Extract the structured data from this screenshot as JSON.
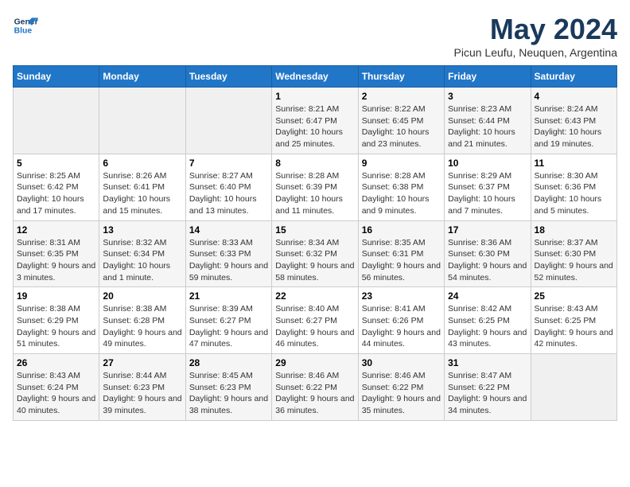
{
  "logo": {
    "line1": "General",
    "line2": "Blue"
  },
  "title": "May 2024",
  "subtitle": "Picun Leufu, Neuquen, Argentina",
  "headers": [
    "Sunday",
    "Monday",
    "Tuesday",
    "Wednesday",
    "Thursday",
    "Friday",
    "Saturday"
  ],
  "weeks": [
    [
      {
        "day": "",
        "empty": true
      },
      {
        "day": "",
        "empty": true
      },
      {
        "day": "",
        "empty": true
      },
      {
        "day": "1",
        "sunrise": "8:21 AM",
        "sunset": "6:47 PM",
        "daylight": "10 hours and 25 minutes."
      },
      {
        "day": "2",
        "sunrise": "8:22 AM",
        "sunset": "6:45 PM",
        "daylight": "10 hours and 23 minutes."
      },
      {
        "day": "3",
        "sunrise": "8:23 AM",
        "sunset": "6:44 PM",
        "daylight": "10 hours and 21 minutes."
      },
      {
        "day": "4",
        "sunrise": "8:24 AM",
        "sunset": "6:43 PM",
        "daylight": "10 hours and 19 minutes."
      }
    ],
    [
      {
        "day": "5",
        "sunrise": "8:25 AM",
        "sunset": "6:42 PM",
        "daylight": "10 hours and 17 minutes."
      },
      {
        "day": "6",
        "sunrise": "8:26 AM",
        "sunset": "6:41 PM",
        "daylight": "10 hours and 15 minutes."
      },
      {
        "day": "7",
        "sunrise": "8:27 AM",
        "sunset": "6:40 PM",
        "daylight": "10 hours and 13 minutes."
      },
      {
        "day": "8",
        "sunrise": "8:28 AM",
        "sunset": "6:39 PM",
        "daylight": "10 hours and 11 minutes."
      },
      {
        "day": "9",
        "sunrise": "8:28 AM",
        "sunset": "6:38 PM",
        "daylight": "10 hours and 9 minutes."
      },
      {
        "day": "10",
        "sunrise": "8:29 AM",
        "sunset": "6:37 PM",
        "daylight": "10 hours and 7 minutes."
      },
      {
        "day": "11",
        "sunrise": "8:30 AM",
        "sunset": "6:36 PM",
        "daylight": "10 hours and 5 minutes."
      }
    ],
    [
      {
        "day": "12",
        "sunrise": "8:31 AM",
        "sunset": "6:35 PM",
        "daylight": "9 hours and 3 minutes."
      },
      {
        "day": "13",
        "sunrise": "8:32 AM",
        "sunset": "6:34 PM",
        "daylight": "10 hours and 1 minute."
      },
      {
        "day": "14",
        "sunrise": "8:33 AM",
        "sunset": "6:33 PM",
        "daylight": "9 hours and 59 minutes."
      },
      {
        "day": "15",
        "sunrise": "8:34 AM",
        "sunset": "6:32 PM",
        "daylight": "9 hours and 58 minutes."
      },
      {
        "day": "16",
        "sunrise": "8:35 AM",
        "sunset": "6:31 PM",
        "daylight": "9 hours and 56 minutes."
      },
      {
        "day": "17",
        "sunrise": "8:36 AM",
        "sunset": "6:30 PM",
        "daylight": "9 hours and 54 minutes."
      },
      {
        "day": "18",
        "sunrise": "8:37 AM",
        "sunset": "6:30 PM",
        "daylight": "9 hours and 52 minutes."
      }
    ],
    [
      {
        "day": "19",
        "sunrise": "8:38 AM",
        "sunset": "6:29 PM",
        "daylight": "9 hours and 51 minutes."
      },
      {
        "day": "20",
        "sunrise": "8:38 AM",
        "sunset": "6:28 PM",
        "daylight": "9 hours and 49 minutes."
      },
      {
        "day": "21",
        "sunrise": "8:39 AM",
        "sunset": "6:27 PM",
        "daylight": "9 hours and 47 minutes."
      },
      {
        "day": "22",
        "sunrise": "8:40 AM",
        "sunset": "6:27 PM",
        "daylight": "9 hours and 46 minutes."
      },
      {
        "day": "23",
        "sunrise": "8:41 AM",
        "sunset": "6:26 PM",
        "daylight": "9 hours and 44 minutes."
      },
      {
        "day": "24",
        "sunrise": "8:42 AM",
        "sunset": "6:25 PM",
        "daylight": "9 hours and 43 minutes."
      },
      {
        "day": "25",
        "sunrise": "8:43 AM",
        "sunset": "6:25 PM",
        "daylight": "9 hours and 42 minutes."
      }
    ],
    [
      {
        "day": "26",
        "sunrise": "8:43 AM",
        "sunset": "6:24 PM",
        "daylight": "9 hours and 40 minutes."
      },
      {
        "day": "27",
        "sunrise": "8:44 AM",
        "sunset": "6:23 PM",
        "daylight": "9 hours and 39 minutes."
      },
      {
        "day": "28",
        "sunrise": "8:45 AM",
        "sunset": "6:23 PM",
        "daylight": "9 hours and 38 minutes."
      },
      {
        "day": "29",
        "sunrise": "8:46 AM",
        "sunset": "6:22 PM",
        "daylight": "9 hours and 36 minutes."
      },
      {
        "day": "30",
        "sunrise": "8:46 AM",
        "sunset": "6:22 PM",
        "daylight": "9 hours and 35 minutes."
      },
      {
        "day": "31",
        "sunrise": "8:47 AM",
        "sunset": "6:22 PM",
        "daylight": "9 hours and 34 minutes."
      },
      {
        "day": "",
        "empty": true
      }
    ]
  ]
}
